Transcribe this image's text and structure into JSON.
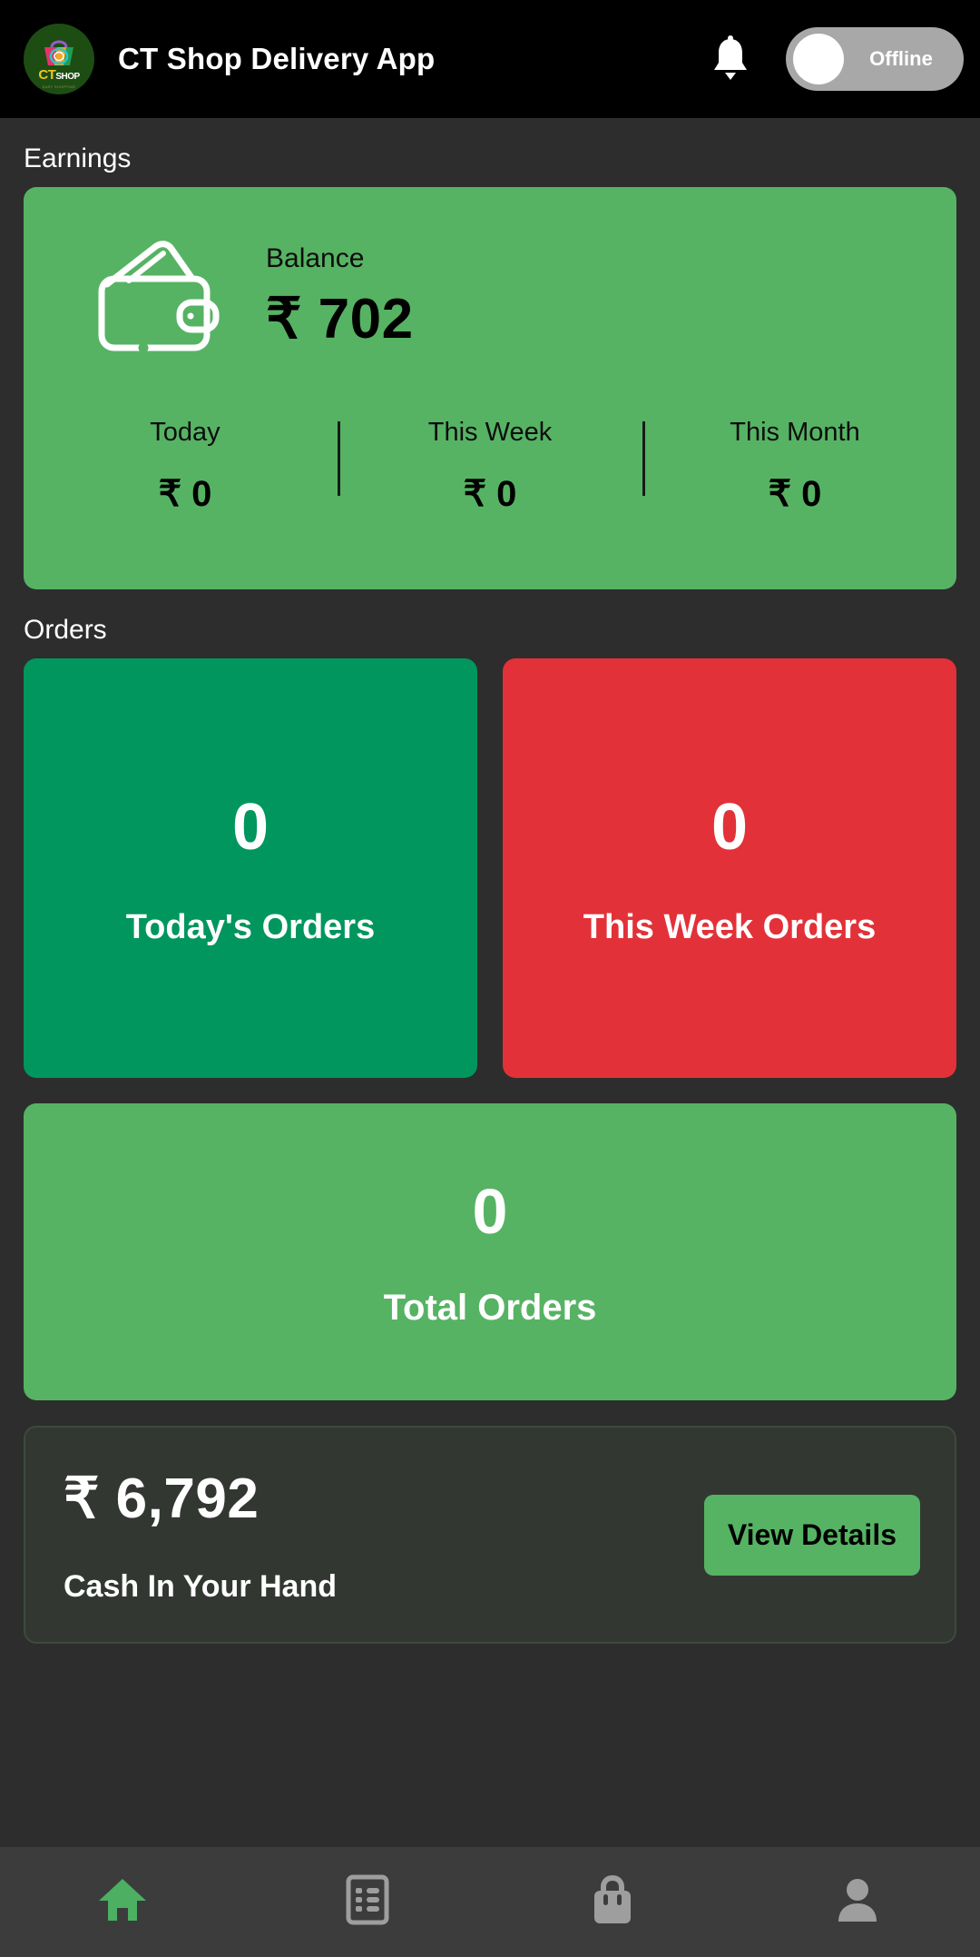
{
  "appbar": {
    "title": "CT Shop Delivery App",
    "logo_primary_text": "CT",
    "logo_secondary_text": "SHOP",
    "logo_tagline": "EASY SHOPPING",
    "bell_icon": "bell-icon",
    "status_toggle_label": "Offline",
    "colors": {
      "bar_bg": "#000000",
      "logo_bg": "#1d4d12",
      "toggle_bg": "#a8a8a8",
      "knob": "#ffffff"
    }
  },
  "earnings": {
    "section_title": "Earnings",
    "wallet_icon": "wallet-icon",
    "balance_label": "Balance",
    "balance_value": "₹ 702",
    "card_color": "#56b363",
    "stats": [
      {
        "label": "Today",
        "value": "₹ 0"
      },
      {
        "label": "This Week",
        "value": "₹ 0"
      },
      {
        "label": "This Month",
        "value": "₹ 0"
      }
    ]
  },
  "orders": {
    "section_title": "Orders",
    "cards": [
      {
        "count": "0",
        "label": "Today's Orders",
        "color": "#00965e"
      },
      {
        "count": "0",
        "label": "This Week Orders",
        "color": "#e23138"
      }
    ],
    "total": {
      "count": "0",
      "label": "Total Orders",
      "color": "#56b363"
    }
  },
  "cash": {
    "amount": "₹ 6,792",
    "label": "Cash In Your Hand",
    "button_label": "View Details",
    "card_bg": "#323732",
    "button_color": "#56b363"
  },
  "bottom_nav": {
    "items": [
      {
        "icon": "home-icon",
        "active": true
      },
      {
        "icon": "list-icon",
        "active": false
      },
      {
        "icon": "shopping-bag-icon",
        "active": false
      },
      {
        "icon": "person-icon",
        "active": false
      }
    ],
    "active_color": "#4caf62",
    "inactive_color": "#9e9e9e",
    "bar_bg": "#3c3c3c"
  }
}
